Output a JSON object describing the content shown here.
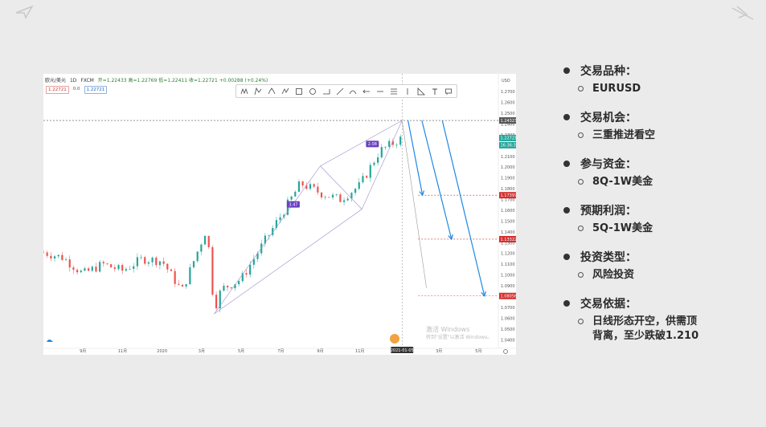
{
  "chart_header": {
    "symbol": "欧元/美元",
    "interval": "1D",
    "source": "FXCM",
    "ohlc": "开=1.22433 高=1.22769 低=1.22411 收=1.22721 +0.00288 (+0.24%)",
    "sell_price": "1.22721",
    "spread": "0.0",
    "buy_price": "1.22721"
  },
  "chart_data": {
    "type": "candlestick",
    "title": "欧元/美元 1D FXCM",
    "xlabel": "",
    "ylabel": "",
    "x_ticks": [
      "9月",
      "11月",
      "2020",
      "3月",
      "5月",
      "7月",
      "9月",
      "11月",
      "2021-01-05",
      "3月",
      "5月"
    ],
    "y_ticks": [
      "1.2700",
      "1.2600",
      "1.2500",
      "1.2400",
      "1.2300",
      "1.2200",
      "1.2100",
      "1.2000",
      "1.1900",
      "1.1800",
      "1.1700",
      "1.1600",
      "1.1500",
      "1.1400",
      "1.1300",
      "1.1200",
      "1.1100",
      "1.1000",
      "1.0900",
      "1.0800",
      "1.0700",
      "1.0600",
      "1.0500",
      "1.0400"
    ],
    "top_axis_label": "USD",
    "ylim": [
      1.035,
      1.282
    ],
    "current_price_labels": [
      "1.22721",
      "16:36:32"
    ],
    "horizontal_levels": [
      {
        "value": 1.24323,
        "label": "1.24323",
        "color": "#555555"
      },
      {
        "value": 1.17397,
        "label": "1.17397",
        "color": "#d32f2f"
      },
      {
        "value": 1.13322,
        "label": "1.13322",
        "color": "#d32f2f"
      },
      {
        "value": 1.08056,
        "label": "1.08056",
        "color": "#d32f2f"
      }
    ],
    "pattern_labels": [
      {
        "text": "3.47",
        "color": "#6a3fc1"
      },
      {
        "text": "2.08",
        "color": "#6a3fc1"
      }
    ],
    "price_path_keypoints": [
      {
        "x": "2019-07",
        "y": 1.121
      },
      {
        "x": "2019-08",
        "y": 1.116
      },
      {
        "x": "2019-09",
        "y": 1.101
      },
      {
        "x": "2019-10",
        "y": 1.11
      },
      {
        "x": "2019-11",
        "y": 1.104
      },
      {
        "x": "2019-12",
        "y": 1.115
      },
      {
        "x": "2020-01",
        "y": 1.113
      },
      {
        "x": "2020-02",
        "y": 1.085
      },
      {
        "x": "2020-03-09",
        "y": 1.144
      },
      {
        "x": "2020-03-20",
        "y": 1.068
      },
      {
        "x": "2020-04",
        "y": 1.087
      },
      {
        "x": "2020-05",
        "y": 1.096
      },
      {
        "x": "2020-06",
        "y": 1.126
      },
      {
        "x": "2020-07",
        "y": 1.155
      },
      {
        "x": "2020-08",
        "y": 1.185
      },
      {
        "x": "2020-09",
        "y": 1.176
      },
      {
        "x": "2020-10",
        "y": 1.17
      },
      {
        "x": "2020-11",
        "y": 1.183
      },
      {
        "x": "2020-12",
        "y": 1.215
      },
      {
        "x": "2021-01-05",
        "y": 1.227
      }
    ],
    "projection_arrows": [
      {
        "from": 1.24323,
        "to": 1.17397
      },
      {
        "from": 1.24323,
        "to": 1.13322
      },
      {
        "from": 1.24323,
        "to": 1.08056
      }
    ],
    "watermark": [
      "激活 Windows",
      "转到\"设置\"以激活 Windows。"
    ]
  },
  "info_panel": {
    "items": [
      {
        "label": "交易品种：",
        "value": "EURUSD"
      },
      {
        "label": "交易机会：",
        "value": "三重推进看空"
      },
      {
        "label": "参与资金：",
        "value": "8Q-1W美金"
      },
      {
        "label": "预期利润：",
        "value": "5Q-1W美金"
      },
      {
        "label": "投资类型：",
        "value": "风险投资"
      },
      {
        "label": "交易依据：",
        "value": "日线形态开空，供需顶背离，至少跌破1.210"
      }
    ]
  },
  "colors": {
    "bull": "#26a69a",
    "bear": "#ef5350",
    "arrow": "#1e88e5",
    "level_red": "#d32f2f",
    "pattern": "#6a3fc1"
  }
}
